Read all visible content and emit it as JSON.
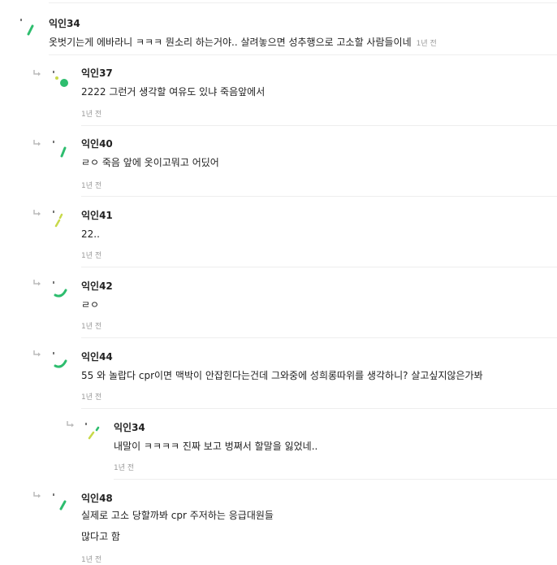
{
  "comments": [
    {
      "author": "익인34",
      "lines": [
        "옷벗기는게 에바라니 ㅋㅋㅋ 뭔소리 하는거야.. 살려놓으면 성추행으로 고소할 사람들이네"
      ],
      "time": "1년 전",
      "avatar": "slash-green"
    },
    {
      "author": "익인37",
      "lines": [
        "2222 그런거 생각할 여유도 있냐 죽음앞에서"
      ],
      "time": "1년 전",
      "avatar": "dot-green"
    },
    {
      "author": "익인40",
      "lines": [
        "ㄹㅇ 죽음 앞에 옷이고뭐고 어딨어"
      ],
      "time": "1년 전",
      "avatar": "slash-green"
    },
    {
      "author": "익인41",
      "lines": [
        "22.."
      ],
      "time": "1년 전",
      "avatar": "slash-lime"
    },
    {
      "author": "익인42",
      "lines": [
        "ㄹㅇ"
      ],
      "time": "1년 전",
      "avatar": "curve-green"
    },
    {
      "author": "익인44",
      "lines": [
        "55 와 놀랍다 cpr이면 맥박이 안잡힌다는건데 그와중에 성희롱따위를 생각하니? 살고싶지않은가봐"
      ],
      "time": "1년 전",
      "avatar": "curve-green"
    },
    {
      "author": "익인34",
      "lines": [
        "내말이 ㅋㅋㅋㅋ 진짜 보고 벙쪄서 할말을 잃었네.."
      ],
      "time": "1년 전",
      "avatar": "slash-lime"
    },
    {
      "author": "익인48",
      "lines": [
        "실제로 고소 당할까봐 cpr 주저하는 응급대원들",
        "많다고 함"
      ],
      "time": "1년 전",
      "avatar": "slash-green"
    }
  ],
  "colors": {
    "green": "#2dbd6e",
    "lime": "#c8d94a",
    "text": "#222222",
    "muted": "#999999",
    "divider": "#eeeeee"
  }
}
